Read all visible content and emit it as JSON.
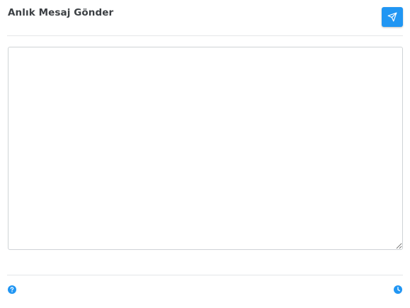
{
  "header": {
    "title": "Anlık Mesaj Gönder",
    "send_icon": "send-icon"
  },
  "message": {
    "value": "",
    "placeholder": ""
  },
  "footer": {
    "left_icon": "help-icon",
    "right_icon": "clock-icon"
  },
  "colors": {
    "accent": "#2196f3",
    "title_text": "#3c4044",
    "divider": "#e4e6e8",
    "border": "#cfd3d6"
  }
}
